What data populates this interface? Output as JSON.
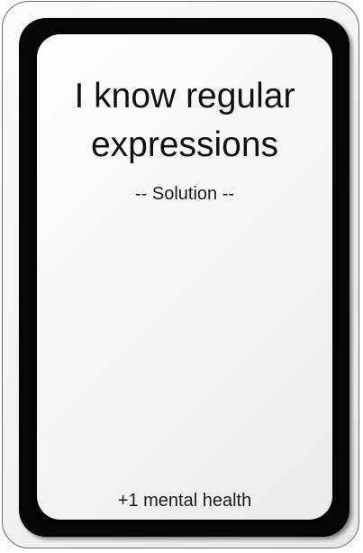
{
  "card": {
    "title_line1": "I know regular",
    "title_line2": "expressions",
    "subtitle": "-- Solution --",
    "footer": "+1 mental health"
  },
  "colors": {
    "border": "#050505",
    "face": "#f3f3f3",
    "text": "#111111"
  }
}
